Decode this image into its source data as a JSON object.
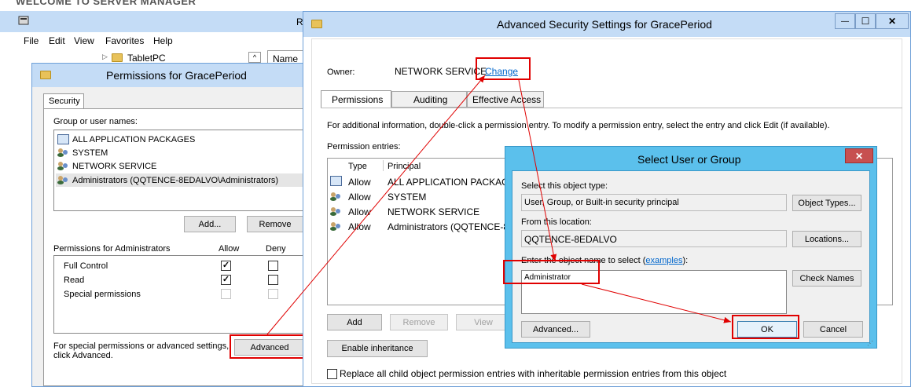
{
  "bg_window": {
    "top_text": "WELCOME TO SERVER MANAGER",
    "title_partial": "R",
    "menu": [
      "File",
      "Edit",
      "View",
      "Favorites",
      "Help"
    ],
    "tree_item": "TabletPC",
    "column_partial": "Name"
  },
  "permissions_dialog": {
    "title": "Permissions for GracePeriod",
    "tab": "Security",
    "group_label": "Group or user names:",
    "users": [
      "ALL APPLICATION PACKAGES",
      "SYSTEM",
      "NETWORK SERVICE",
      "Administrators (QQTENCE-8EDALVO\\Administrators)"
    ],
    "add_button": "Add...",
    "remove_button": "Remove",
    "perm_for": "Permissions for Administrators",
    "allow_col": "Allow",
    "deny_col": "Deny",
    "perms": [
      {
        "name": "Full Control",
        "allow": true,
        "deny": false
      },
      {
        "name": "Read",
        "allow": true,
        "deny": false
      },
      {
        "name": "Special permissions",
        "allow": false,
        "deny": false
      }
    ],
    "special_text_1": "For special permissions or advanced settings,",
    "special_text_2": "click Advanced.",
    "advanced_button": "Advanced"
  },
  "advanced_dialog": {
    "title": "Advanced Security Settings for GracePeriod",
    "owner_label": "Owner:",
    "owner_value": "NETWORK SERVICE",
    "change_link": "Change",
    "tabs": [
      "Permissions",
      "Auditing",
      "Effective Access"
    ],
    "info_text": "For additional information, double-click a permission entry. To modify a permission entry, select the entry and click Edit (if available).",
    "entries_label": "Permission entries:",
    "col_type": "Type",
    "col_principal": "Principal",
    "entries": [
      {
        "type": "Allow",
        "principal": "ALL APPLICATION PACKAGE"
      },
      {
        "type": "Allow",
        "principal": "SYSTEM"
      },
      {
        "type": "Allow",
        "principal": "NETWORK SERVICE"
      },
      {
        "type": "Allow",
        "principal": "Administrators (QQTENCE-8"
      }
    ],
    "add_button": "Add",
    "remove_button": "Remove",
    "view_button": "View",
    "enable_inheritance": "Enable inheritance",
    "replace_text": "Replace all child object permission entries with inheritable permission entries from this object",
    "min_glyph": "—",
    "max_glyph": "☐",
    "close_glyph": "✕"
  },
  "select_dialog": {
    "title": "Select User or Group",
    "close_glyph": "✕",
    "object_type_label": "Select this object type:",
    "object_type_value": "User, Group, or Built-in security principal",
    "object_types_button": "Object Types...",
    "location_label": "From this location:",
    "location_value": "QQTENCE-8EDALVO",
    "locations_button": "Locations...",
    "enter_label_1": "Enter the object name to select (",
    "enter_label_link": "examples",
    "enter_label_2": "):",
    "object_name_value": "Administrator",
    "check_names_button": "Check Names",
    "advanced_button": "Advanced...",
    "ok_button": "OK",
    "cancel_button": "Cancel"
  },
  "colors": {
    "annotation_red": "#e00000",
    "title_blue": "#c4dcf6",
    "select_title": "#5bc0ec",
    "link": "#0066cc"
  }
}
